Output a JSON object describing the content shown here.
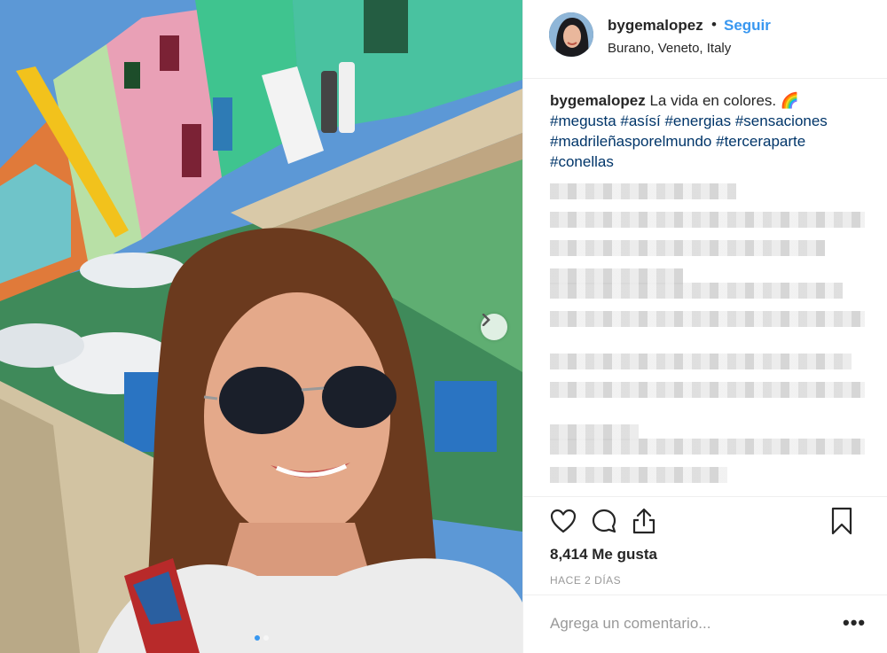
{
  "post": {
    "username": "bygemalopez",
    "separator": "•",
    "follow_label": "Seguir",
    "location": "Burano, Veneto, Italy",
    "caption_username": "bygemalopez",
    "caption_text": "La vida en colores. 🌈",
    "hashtags_line1": "#megusta #asísí #energias #sensaciones",
    "hashtags_line2": "#madrileñasporelmundo #terceraparte",
    "hashtags_line3": "#conellas",
    "likes": "8,414 Me gusta",
    "time": "HACE 2 DÍAS",
    "comment_placeholder": "Agrega un comentario...",
    "more_label": "•••"
  },
  "icons": {
    "like": "heart-icon",
    "comment": "comment-bubble-icon",
    "share": "share-upload-icon",
    "save": "bookmark-icon",
    "next": "chevron-right-icon"
  },
  "colors": {
    "link_blue": "#3897f0",
    "hashtag": "#003569",
    "text": "#262626",
    "muted": "#999999"
  },
  "carousel": {
    "slides": 2,
    "active": 1
  }
}
